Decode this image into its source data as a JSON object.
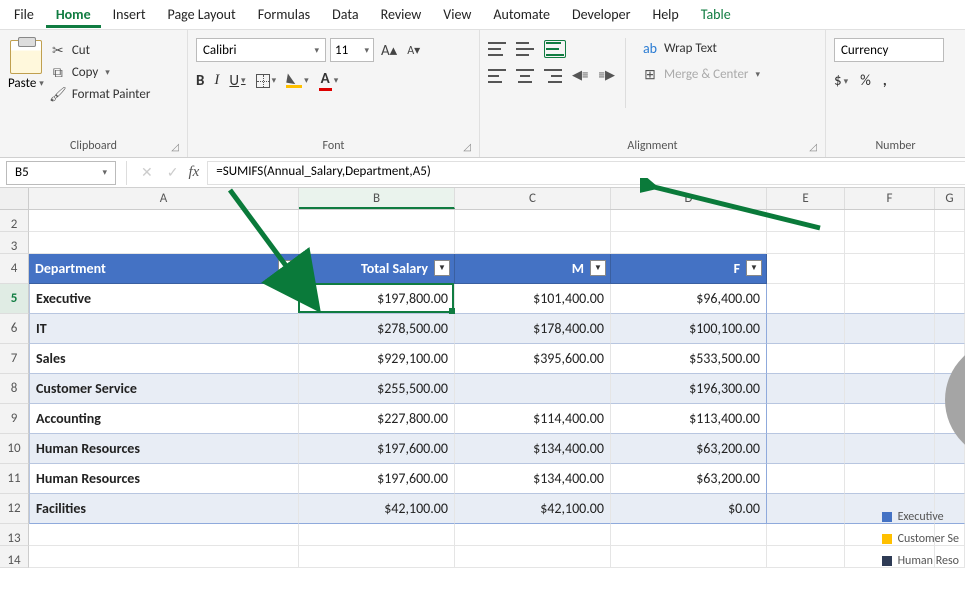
{
  "menubar": {
    "items": [
      "File",
      "Home",
      "Insert",
      "Page Layout",
      "Formulas",
      "Data",
      "Review",
      "View",
      "Automate",
      "Developer",
      "Help",
      "Table"
    ],
    "active": "Home"
  },
  "ribbon": {
    "clipboard": {
      "label": "Clipboard",
      "paste": "Paste",
      "cut": "Cut",
      "copy": "Copy",
      "format_painter": "Format Painter"
    },
    "font": {
      "label": "Font",
      "name": "Calibri",
      "size": "11"
    },
    "alignment": {
      "label": "Alignment",
      "wrap": "Wrap Text",
      "merge": "Merge & Center"
    },
    "number": {
      "label": "Number",
      "format": "Currency"
    }
  },
  "namebox": "B5",
  "formula": "=SUMIFS(Annual_Salary,Department,A5)",
  "columns": [
    "A",
    "B",
    "C",
    "D",
    "E",
    "F",
    "G"
  ],
  "row_start": 2,
  "row_end": 14,
  "active_row": 5,
  "table": {
    "headers": [
      "Department",
      "Total Salary",
      "M",
      "F"
    ],
    "rows": [
      {
        "dept": "Executive",
        "total": "$197,800.00",
        "m": "$101,400.00",
        "f": "$96,400.00"
      },
      {
        "dept": "IT",
        "total": "$278,500.00",
        "m": "$178,400.00",
        "f": "$100,100.00"
      },
      {
        "dept": "Sales",
        "total": "$929,100.00",
        "m": "$395,600.00",
        "f": "$533,500.00"
      },
      {
        "dept": "Customer Service",
        "total": "$255,500.00",
        "m": "",
        "f": "$196,300.00"
      },
      {
        "dept": "Accounting",
        "total": "$227,800.00",
        "m": "$114,400.00",
        "f": "$113,400.00"
      },
      {
        "dept": "Human Resources",
        "total": "$197,600.00",
        "m": "$134,400.00",
        "f": "$63,200.00"
      },
      {
        "dept": "Human Resources",
        "total": "$197,600.00",
        "m": "$134,400.00",
        "f": "$63,200.00"
      },
      {
        "dept": "Facilities",
        "total": "$42,100.00",
        "m": "$42,100.00",
        "f": "$0.00"
      }
    ]
  },
  "legend": [
    {
      "color": "#4472c4",
      "label": "Executive"
    },
    {
      "color": "#ffc000",
      "label": "Customer Se"
    },
    {
      "color": "#2e3b55",
      "label": "Human Reso"
    }
  ]
}
